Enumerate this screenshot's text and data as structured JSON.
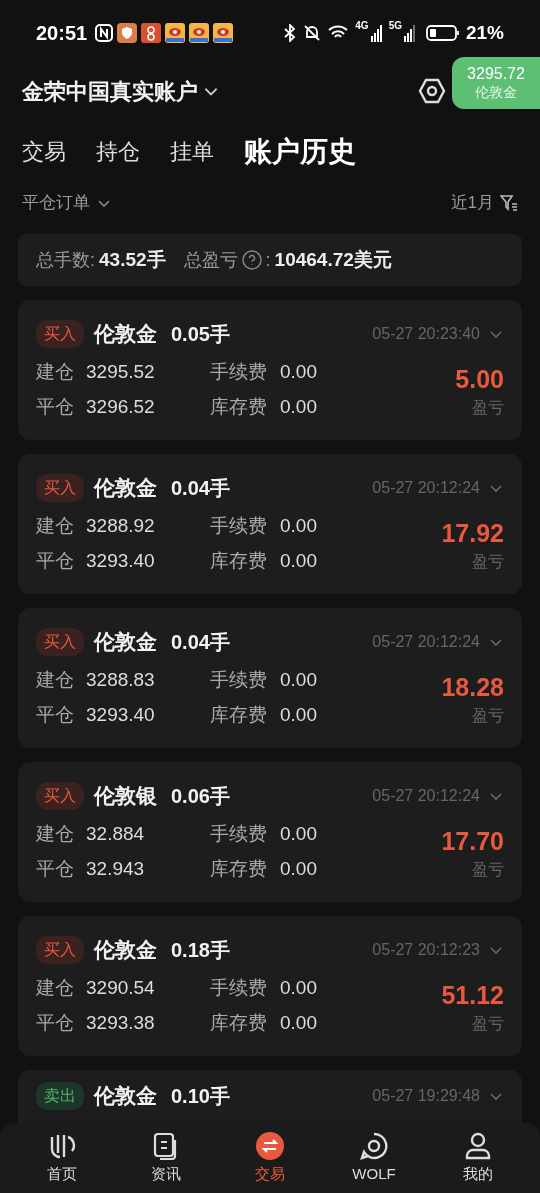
{
  "status_bar": {
    "time": "20:51",
    "network_4g": "4G",
    "network_5g": "5G",
    "battery": "21%"
  },
  "account": {
    "title": "金荣中国真实账户"
  },
  "price_badge": {
    "price": "3295.72",
    "symbol": "伦敦金"
  },
  "tabs": [
    {
      "label": "交易",
      "selected": false
    },
    {
      "label": "持仓",
      "selected": false
    },
    {
      "label": "挂单",
      "selected": false
    },
    {
      "label": "账户历史",
      "selected": true
    }
  ],
  "filter": {
    "order_type": "平仓订单",
    "period": "近1月"
  },
  "summary": {
    "lots_label": "总手数:",
    "lots_value": "43.52手",
    "pnl_label": "总盈亏",
    "pnl_colon": ":",
    "pnl_value": "10464.72美元"
  },
  "orders": [
    {
      "side": "买入",
      "kind": "buy",
      "symbol": "伦敦金",
      "lots": "0.05手",
      "time": "05-27 20:23:40",
      "open_label": "建仓",
      "open": "3295.52",
      "close_label": "平仓",
      "close": "3296.52",
      "fee_label": "手续费",
      "fee": "0.00",
      "swap_label": "库存费",
      "swap": "0.00",
      "pnl": "5.00",
      "pnl_label": "盈亏"
    },
    {
      "side": "买入",
      "kind": "buy",
      "symbol": "伦敦金",
      "lots": "0.04手",
      "time": "05-27 20:12:24",
      "open_label": "建仓",
      "open": "3288.92",
      "close_label": "平仓",
      "close": "3293.40",
      "fee_label": "手续费",
      "fee": "0.00",
      "swap_label": "库存费",
      "swap": "0.00",
      "pnl": "17.92",
      "pnl_label": "盈亏"
    },
    {
      "side": "买入",
      "kind": "buy",
      "symbol": "伦敦金",
      "lots": "0.04手",
      "time": "05-27 20:12:24",
      "open_label": "建仓",
      "open": "3288.83",
      "close_label": "平仓",
      "close": "3293.40",
      "fee_label": "手续费",
      "fee": "0.00",
      "swap_label": "库存费",
      "swap": "0.00",
      "pnl": "18.28",
      "pnl_label": "盈亏"
    },
    {
      "side": "买入",
      "kind": "buy",
      "symbol": "伦敦银",
      "lots": "0.06手",
      "time": "05-27 20:12:24",
      "open_label": "建仓",
      "open": "32.884",
      "close_label": "平仓",
      "close": "32.943",
      "fee_label": "手续费",
      "fee": "0.00",
      "swap_label": "库存费",
      "swap": "0.00",
      "pnl": "17.70",
      "pnl_label": "盈亏"
    },
    {
      "side": "买入",
      "kind": "buy",
      "symbol": "伦敦金",
      "lots": "0.18手",
      "time": "05-27 20:12:23",
      "open_label": "建仓",
      "open": "3290.54",
      "close_label": "平仓",
      "close": "3293.38",
      "fee_label": "手续费",
      "fee": "0.00",
      "swap_label": "库存费",
      "swap": "0.00",
      "pnl": "51.12",
      "pnl_label": "盈亏"
    },
    {
      "side": "卖出",
      "kind": "sell",
      "symbol": "伦敦金",
      "lots": "0.10手",
      "time": "05-27 19:29:48"
    }
  ],
  "bottom_nav": [
    {
      "label": "首页",
      "kind": "home",
      "selected": false
    },
    {
      "label": "资讯",
      "kind": "news",
      "selected": false
    },
    {
      "label": "交易",
      "kind": "trade",
      "selected": true
    },
    {
      "label": "WOLF",
      "kind": "wolf",
      "selected": false
    },
    {
      "label": "我的",
      "kind": "profile",
      "selected": false
    }
  ]
}
